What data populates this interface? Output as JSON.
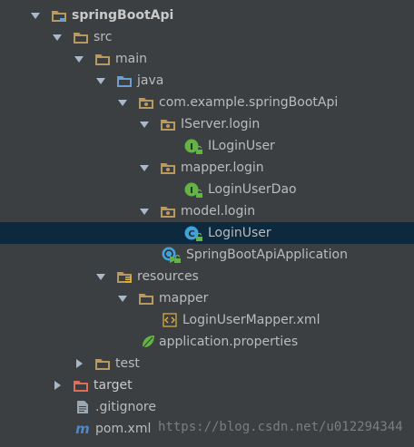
{
  "tree": {
    "project": "springBootApi",
    "src": "src",
    "main": "main",
    "java": "java",
    "package": "com.example.springBootApi",
    "iserver_pkg": "IServer.login",
    "iloginuser": "ILoginUser",
    "mapper_pkg": "mapper.login",
    "loginuserdao": "LoginUserDao",
    "model_pkg": "model.login",
    "loginuser": "LoginUser",
    "app_class": "SpringBootApiApplication",
    "resources": "resources",
    "mapper_dir": "mapper",
    "mapper_xml": "LoginUserMapper.xml",
    "app_props": "application.properties",
    "test": "test",
    "target": "target",
    "gitignore": ".gitignore",
    "pom": "pom.xml"
  },
  "icons": {
    "interface_badge": "I",
    "class_badge": "C",
    "maven_badge": "m"
  },
  "watermark": "https://blog.csdn.net/u012294344",
  "colors": {
    "background": "#3c3f41",
    "selection": "#0d293e",
    "text": "#bbbbbb",
    "folder": "#b89a61",
    "source_folder": "#6a9fce",
    "interface_green": "#62b543",
    "class_blue": "#40a2d8",
    "excluded_red": "#e06c5a"
  }
}
